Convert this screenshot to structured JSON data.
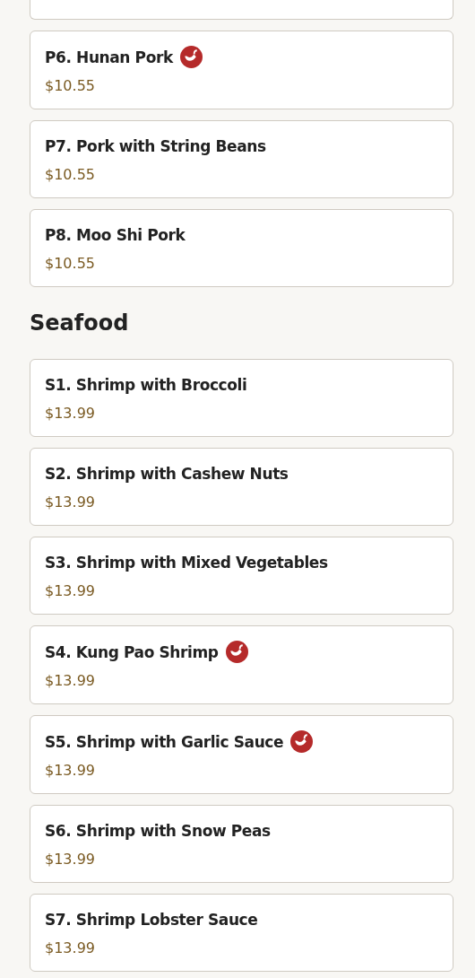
{
  "sections": [
    {
      "items": [
        {
          "name": "P6. Hunan Pork",
          "price": "$10.55",
          "spicy": true
        },
        {
          "name": "P7. Pork with String Beans",
          "price": "$10.55",
          "spicy": false
        },
        {
          "name": "P8. Moo Shi Pork",
          "price": "$10.55",
          "spicy": false
        }
      ]
    },
    {
      "heading": "Seafood",
      "items": [
        {
          "name": "S1. Shrimp with Broccoli",
          "price": "$13.99",
          "spicy": false
        },
        {
          "name": "S2. Shrimp with Cashew Nuts",
          "price": "$13.99",
          "spicy": false
        },
        {
          "name": "S3. Shrimp with Mixed Vegetables",
          "price": "$13.99",
          "spicy": false
        },
        {
          "name": "S4. Kung Pao Shrimp",
          "price": "$13.99",
          "spicy": true
        },
        {
          "name": "S5. Shrimp with Garlic Sauce",
          "price": "$13.99",
          "spicy": true
        },
        {
          "name": "S6. Shrimp with Snow Peas",
          "price": "$13.99",
          "spicy": false
        },
        {
          "name": "S7. Shrimp Lobster Sauce",
          "price": "$13.99",
          "spicy": false
        }
      ]
    }
  ]
}
